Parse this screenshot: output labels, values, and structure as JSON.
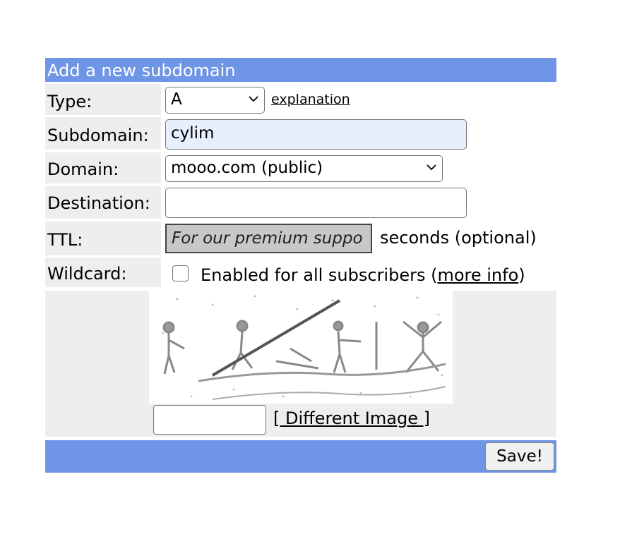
{
  "form": {
    "header": "Add a new subdomain",
    "type": {
      "label": "Type:",
      "value": "A",
      "link": "explanation"
    },
    "subdomain": {
      "label": "Subdomain:",
      "value": "cylim"
    },
    "domain": {
      "label": "Domain:",
      "value": "mooo.com (public)"
    },
    "destination": {
      "label": "Destination:",
      "value": ""
    },
    "ttl": {
      "label": "TTL:",
      "value": "For our premium suppo",
      "suffix": "seconds (optional)"
    },
    "wildcard": {
      "label": "Wildcard:",
      "text_before": "Enabled for all subscribers (",
      "link": "more info",
      "text_after": ")"
    },
    "captcha": {
      "different_image": "[ Different Image ]",
      "value": ""
    },
    "save": "Save!"
  },
  "icons": {
    "chevron": "chevron-down-icon"
  },
  "colors": {
    "header_bg": "#6f95e6",
    "label_bg": "#eeeeee",
    "autofill_bg": "#e8effc"
  }
}
